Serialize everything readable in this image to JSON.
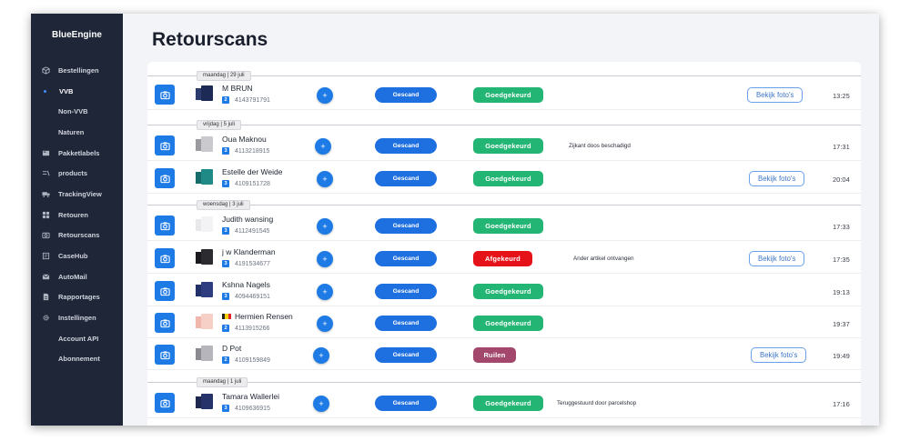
{
  "app": {
    "brand": "BlueEngine"
  },
  "sidebar": {
    "items": [
      {
        "label": "Bestellingen",
        "icon": "box-icon",
        "sub": false,
        "active": false
      },
      {
        "label": "VVB",
        "icon": "dot-icon",
        "sub": true,
        "active": true
      },
      {
        "label": "Non-VVB",
        "icon": "",
        "sub": true,
        "active": false
      },
      {
        "label": "Naturen",
        "icon": "",
        "sub": true,
        "active": false
      },
      {
        "label": "Pakketlabels",
        "icon": "label-icon",
        "sub": false,
        "active": false
      },
      {
        "label": "products",
        "icon": "products-icon",
        "sub": false,
        "active": false
      },
      {
        "label": "TrackingView",
        "icon": "truck-icon",
        "sub": false,
        "active": false
      },
      {
        "label": "Retouren",
        "icon": "grid-icon",
        "sub": false,
        "active": false
      },
      {
        "label": "Retourscans",
        "icon": "camera-icon",
        "sub": false,
        "active": false
      },
      {
        "label": "CaseHub",
        "icon": "case-icon",
        "sub": false,
        "active": false
      },
      {
        "label": "AutoMail",
        "icon": "mail-icon",
        "sub": false,
        "active": false
      },
      {
        "label": "Rapportages",
        "icon": "report-icon",
        "sub": false,
        "active": false
      },
      {
        "label": "Instellingen",
        "icon": "gear-icon",
        "sub": false,
        "active": false
      },
      {
        "label": "Account API",
        "icon": "",
        "sub": true,
        "active": false
      },
      {
        "label": "Abonnement",
        "icon": "",
        "sub": true,
        "active": false
      }
    ]
  },
  "page": {
    "title": "Retourscans"
  },
  "labels": {
    "scanned": "Gescand",
    "photos": "Bekijk foto's"
  },
  "colors": {
    "primary": "#1e7be6",
    "ok": "#22b573",
    "rejected": "#e6121a",
    "swap": "#a3476d",
    "sidebar": "#1e2637"
  },
  "groups": [
    {
      "date": "maandag | 29 juli",
      "rows": [
        {
          "name": "M BRUN",
          "tracking": "4143791791",
          "badge": "2",
          "status": "Goedgekeurd",
          "status_kind": "ok",
          "note": "",
          "photos": true,
          "time": "13:25",
          "colorA": "#2a3a6c",
          "colorB": "#1d2a55",
          "flag": false
        }
      ]
    },
    {
      "date": "vrijdag | 5 juli",
      "rows": [
        {
          "name": "Oua Maknou",
          "tracking": "4113218915",
          "badge": "3",
          "status": "Goedgekeurd",
          "status_kind": "ok",
          "note": "Zijkant doos beschadigd",
          "photos": false,
          "time": "17:31",
          "colorA": "#9a9aa0",
          "colorB": "#c9c9ce",
          "flag": false
        },
        {
          "name": "Estelle der Weide",
          "tracking": "4109151728",
          "badge": "3",
          "status": "Goedgekeurd",
          "status_kind": "ok",
          "note": "",
          "photos": true,
          "time": "20:04",
          "colorA": "#166b6b",
          "colorB": "#1f8a86",
          "flag": false
        }
      ]
    },
    {
      "date": "woensdag | 3 juli",
      "rows": [
        {
          "name": "Judith wansing",
          "tracking": "4112491545",
          "badge": "3",
          "status": "Goedgekeurd",
          "status_kind": "ok",
          "note": "",
          "photos": false,
          "time": "17:33",
          "colorA": "#e8e8ec",
          "colorB": "#f3f3f6",
          "flag": false
        },
        {
          "name": "j w Klanderman",
          "tracking": "4191534677",
          "badge": "3",
          "status": "Afgekeurd",
          "status_kind": "bad",
          "note": "Ander artikel ontvangen",
          "photos": true,
          "time": "17:35",
          "colorA": "#1a1a1e",
          "colorB": "#2b2b30",
          "flag": false
        },
        {
          "name": "Kshna Nagels",
          "tracking": "4094469151",
          "badge": "3",
          "status": "Goedgekeurd",
          "status_kind": "ok",
          "note": "",
          "photos": false,
          "time": "19:13",
          "colorA": "#22306a",
          "colorB": "#2d3d80",
          "flag": false
        },
        {
          "name": "Hermien Rensen",
          "tracking": "4113915266",
          "badge": "2",
          "status": "Goedgekeurd",
          "status_kind": "ok",
          "note": "",
          "photos": false,
          "time": "19:37",
          "colorA": "#f0b8ad",
          "colorB": "#f6cfc6",
          "flag": true
        },
        {
          "name": "D Pot",
          "tracking": "4109159849",
          "badge": "2",
          "status": "Ruilen",
          "status_kind": "swap",
          "note": "",
          "photos": true,
          "time": "19:49",
          "colorA": "#8a8a90",
          "colorB": "#b5b5bb",
          "flag": false
        }
      ]
    },
    {
      "date": "maandag | 1 juli",
      "rows": [
        {
          "name": "Tamara Wallerlei",
          "tracking": "4109636915",
          "badge": "3",
          "status": "Goedgekeurd",
          "status_kind": "ok",
          "note": "Teruggestuurd door parcelshop",
          "photos": false,
          "time": "17:16",
          "colorA": "#1d2750",
          "colorB": "#26336a",
          "flag": false
        }
      ]
    }
  ]
}
